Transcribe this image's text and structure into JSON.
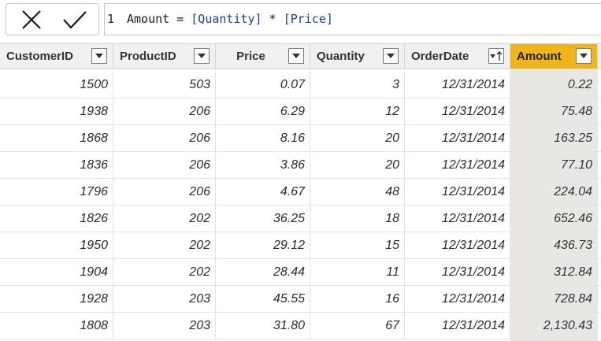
{
  "formula_bar": {
    "cancel_icon": "close-x-icon",
    "commit_icon": "checkmark-icon",
    "line_number": "1",
    "measure_name": "Amount",
    "operator_equals": " = ",
    "ref_quantity": "[Quantity]",
    "operator_multiply": " * ",
    "ref_price": "[Price]"
  },
  "table": {
    "columns": [
      {
        "label": "CustomerID",
        "icon": "chevron-down-icon"
      },
      {
        "label": "ProductID",
        "icon": "chevron-down-icon"
      },
      {
        "label": "Price",
        "icon": "chevron-down-icon"
      },
      {
        "label": "Quantity",
        "icon": "chevron-down-icon"
      },
      {
        "label": "OrderDate",
        "icon": "sort-ascending-dropdown-icon"
      },
      {
        "label": "Amount",
        "icon": "chevron-down-icon"
      }
    ],
    "selected_column": "Amount",
    "rows": [
      [
        "1500",
        "503",
        "0.07",
        "3",
        "12/31/2014",
        "0.22"
      ],
      [
        "1938",
        "206",
        "6.29",
        "12",
        "12/31/2014",
        "75.48"
      ],
      [
        "1868",
        "206",
        "8.16",
        "20",
        "12/31/2014",
        "163.25"
      ],
      [
        "1836",
        "206",
        "3.86",
        "20",
        "12/31/2014",
        "77.10"
      ],
      [
        "1796",
        "206",
        "4.67",
        "48",
        "12/31/2014",
        "224.04"
      ],
      [
        "1826",
        "202",
        "36.25",
        "18",
        "12/31/2014",
        "652.46"
      ],
      [
        "1950",
        "202",
        "29.12",
        "15",
        "12/31/2014",
        "436.73"
      ],
      [
        "1904",
        "202",
        "28.44",
        "11",
        "12/31/2014",
        "312.84"
      ],
      [
        "1928",
        "203",
        "45.55",
        "16",
        "12/31/2014",
        "728.84"
      ],
      [
        "1808",
        "203",
        "31.80",
        "67",
        "12/31/2014",
        "2,130.43"
      ]
    ]
  },
  "colors": {
    "selected_header": "#efb61c",
    "selected_column_bg": "#e9e7e4",
    "header_bg": "#f1f1f1",
    "reference_text": "#1f3f8c"
  }
}
